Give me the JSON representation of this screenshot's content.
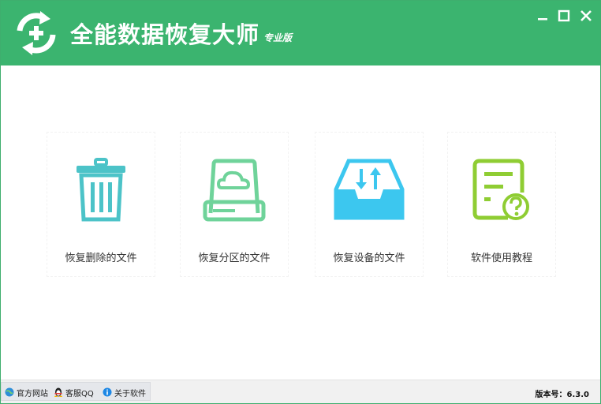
{
  "app": {
    "title": "全能数据恢复大师",
    "edition": "专业版",
    "brand_color": "#3bb46f"
  },
  "window_controls": [
    "minimize",
    "maximize",
    "close"
  ],
  "features": [
    {
      "label": "恢复删除的文件",
      "icon": "trash-bin-icon",
      "color": "#4cc3c8"
    },
    {
      "label": "恢复分区的文件",
      "icon": "cloud-drive-icon",
      "color": "#6fd39a"
    },
    {
      "label": "恢复设备的文件",
      "icon": "device-tray-icon",
      "color": "#3cc7ef"
    },
    {
      "label": "软件使用教程",
      "icon": "help-document-icon",
      "color": "#8fcd33"
    }
  ],
  "statusbar": {
    "links": [
      {
        "label": "官方网站",
        "icon": "globe-icon"
      },
      {
        "label": "客服QQ",
        "icon": "qq-penguin-icon"
      },
      {
        "label": "关于软件",
        "icon": "info-icon"
      }
    ],
    "version": "版本号：6.3.0"
  }
}
